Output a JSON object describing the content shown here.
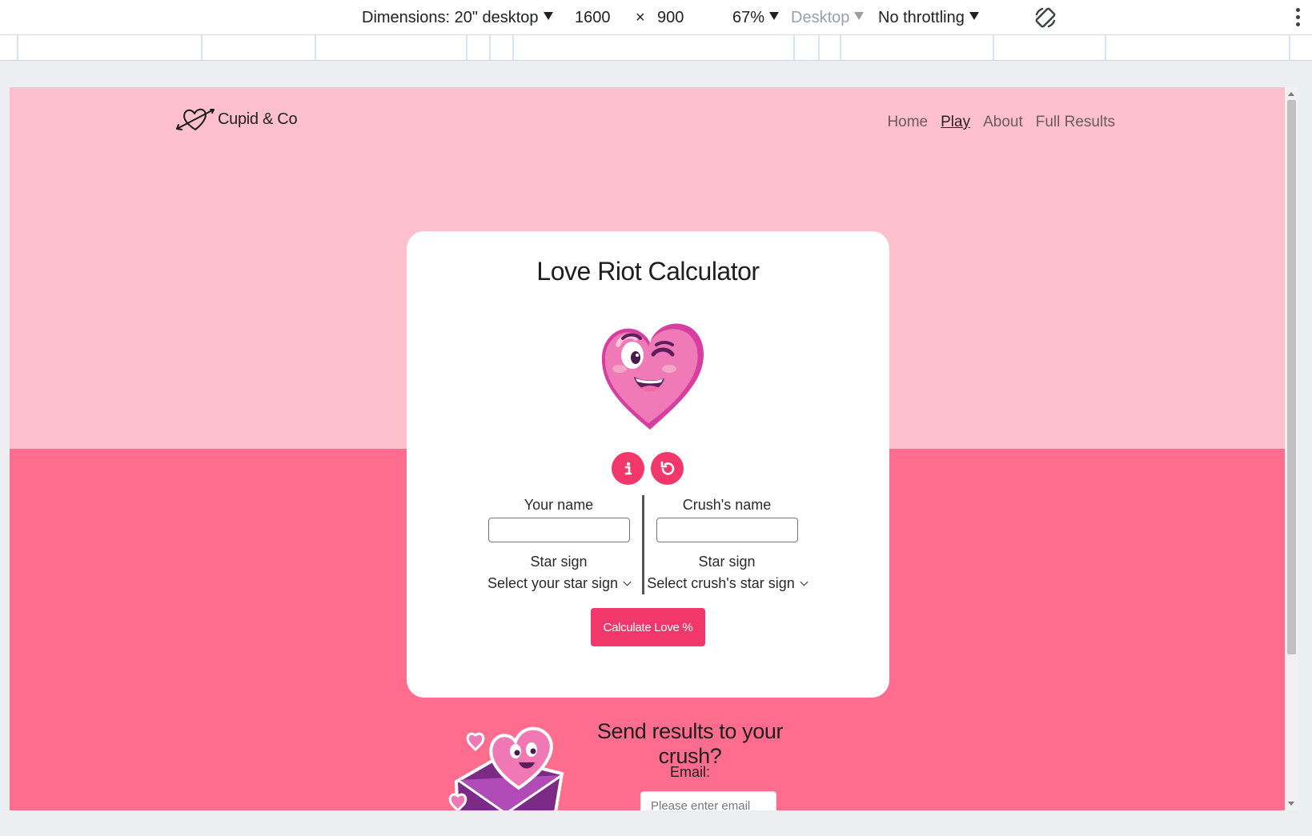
{
  "devtools": {
    "dimensions_label": "Dimensions: 20\" desktop",
    "width": "1600",
    "times": "×",
    "height": "900",
    "zoom": "67%",
    "device_type": "Desktop",
    "throttling": "No throttling"
  },
  "site": {
    "brand": "Cupid & Co",
    "nav": [
      {
        "label": "Home"
      },
      {
        "label": "Play"
      },
      {
        "label": "About"
      },
      {
        "label": "Full Results"
      }
    ]
  },
  "calculator": {
    "title": "Love Riot Calculator",
    "your_name_label": "Your name",
    "crush_name_label": "Crush's name",
    "star_sign_label": "Star sign",
    "your_star_select": "Select your star sign",
    "crush_star_select": "Select crush's star sign",
    "calculate_label": "Calculate Love %"
  },
  "send": {
    "title": "Send results to your crush?",
    "email_label": "Email:",
    "email_placeholder": "Please enter email"
  },
  "colors": {
    "top_band": "#ffc0cd",
    "bottom_band": "#fe6d8e",
    "accent": "#f2386a"
  }
}
